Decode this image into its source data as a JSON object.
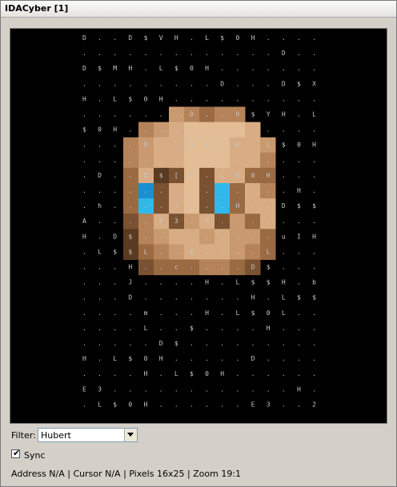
{
  "window": {
    "title": "IDACyber [1]"
  },
  "filter": {
    "label": "Filter:",
    "value": "Hubert"
  },
  "sync": {
    "label": "Sync",
    "checked": true
  },
  "status": {
    "text": "Address N/A | Cursor N/A | Pixels 16x25  | Zoom 19:1"
  },
  "ascii_rows": [
    "D . . D $ V H . L $ 0 H . . . .",
    ". . . . . . . . . . . . . D . .",
    "D $ M H . L $ 0 H . . . . . . .",
    ". . . . . . . . . D . . . D $ X",
    "H . L $ 0 H . . . . . . . . . .",
    ". . . . . . . D . . D $ Y H . L",
    "$ 0 H . . . . . . . . . . . . .",
    ". . . . D . . D $ I H . L $ 0 H",
    ". . . . . . . . . . . . . . . .",
    ". D . . D $ [ H . L $ 0 H . . .",
    ". . . . . . . . . . . . . . H .",
    ". h . . . . ) . . . H . . D $ $",
    "A . . . . E 3 . H . . . . . . .",
    "H . D $ . . . . . . . . . u I H",
    ". L $ $ L . . $ . . . . L . . .",
    ". . . H . . c . . . . D $ . . .",
    ". . . J . . . . H . L $ $ H . b",
    ". . . D . . . . . . . H . L $ $",
    ". . . . m . . . H . L $ 0 L . .",
    ". . . . L . . $ . . . . H . . .",
    ". . . . . D $ . . . . . . . . .",
    "H . L $ 0 H . . . . . D . . . .",
    ". . . . H . L $ 0 H . . . . . .",
    "E 3 . . . . . . . . . . . . H .",
    ". L $ 0 H . . . . . . E 3 . . 2"
  ],
  "sprite": {
    "palette": {
      "1": "#5a3a20",
      "2": "#7a5232",
      "3": "#9a6a43",
      "4": "#b5835a",
      "5": "#c99a70",
      "6": "#d8ad85",
      "7": "#e2bd96",
      "8": "#efcaa2",
      "9": "#30b8e8",
      "A": "#1a8fd0"
    },
    "rows": [
      "................",
      "................",
      "................",
      "................",
      "................",
      "......54344.....",
      "....45677776....",
      "...4566777665...",
      "...4566777664...",
      "...3612726633...",
      "...3A26729364...",
      "...3926729366...",
      "...2462562536...",
      "...1456656553...",
      "...1345666543...",
      "....23334432....",
      "................",
      "................",
      "................",
      "................",
      "................",
      "................",
      "................",
      "................",
      "................"
    ]
  },
  "colors": {
    "canvas_bg": "#000000",
    "ascii_text": "#c8c8c8"
  }
}
